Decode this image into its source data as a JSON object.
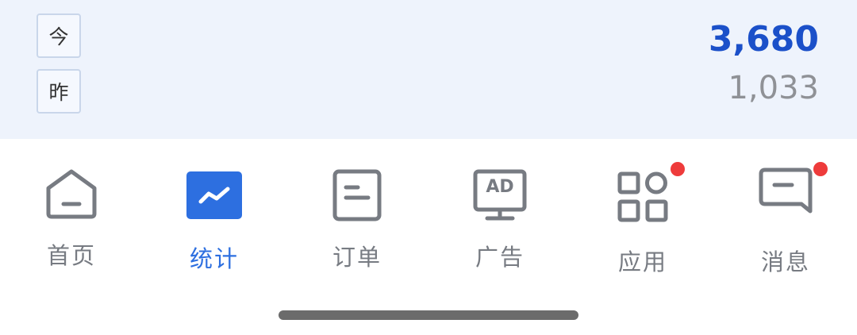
{
  "stats": {
    "today_tag": "今",
    "yesterday_tag": "昨",
    "today_value": "3,680",
    "yesterday_value": "1,033"
  },
  "tabs": [
    {
      "label": "首页",
      "icon": "home-icon",
      "active": false,
      "badge": false
    },
    {
      "label": "统计",
      "icon": "stats-icon",
      "active": true,
      "badge": false
    },
    {
      "label": "订单",
      "icon": "order-icon",
      "active": false,
      "badge": false
    },
    {
      "label": "广告",
      "icon": "ad-icon",
      "active": false,
      "badge": false,
      "icon_text": "AD"
    },
    {
      "label": "应用",
      "icon": "apps-icon",
      "active": false,
      "badge": true
    },
    {
      "label": "消息",
      "icon": "message-icon",
      "active": false,
      "badge": true
    }
  ],
  "colors": {
    "accent": "#2d6fe0",
    "today_value": "#1b50c9",
    "inactive": "#777b82",
    "badge": "#ee3b3b",
    "panel_bg": "#eef3fc"
  }
}
